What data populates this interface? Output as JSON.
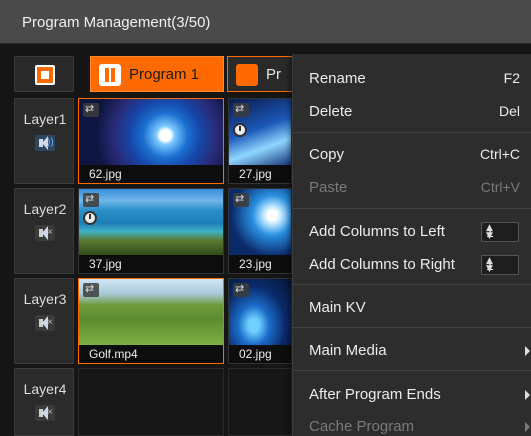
{
  "window": {
    "title": "Program Management(3/50)"
  },
  "toolbar": {
    "programs": [
      {
        "label": "Program 1",
        "state": "playing",
        "active": true
      },
      {
        "label": "Pr",
        "state": "paused",
        "active": false
      }
    ]
  },
  "layers": [
    {
      "name": "Layer1",
      "audio": "on",
      "audio_icon": "speaker-on-icon"
    },
    {
      "name": "Layer2",
      "audio": "muted",
      "audio_icon": "speaker-muted-icon"
    },
    {
      "name": "Layer3",
      "audio": "muted",
      "audio_icon": "speaker-muted-icon"
    },
    {
      "name": "Layer4",
      "audio": "muted",
      "audio_icon": "speaker-muted-icon"
    }
  ],
  "media": {
    "l1c1": {
      "file": "62.jpg"
    },
    "l1c2": {
      "file": "27.jpg"
    },
    "l2c1": {
      "file": "37.jpg"
    },
    "l2c2": {
      "file": "23.jpg"
    },
    "l3c1": {
      "file": "Golf.mp4"
    },
    "l3c2": {
      "file": "02.jpg"
    }
  },
  "context_menu": {
    "rename": {
      "label": "Rename",
      "shortcut": "F2"
    },
    "delete": {
      "label": "Delete",
      "shortcut": "Del"
    },
    "copy": {
      "label": "Copy",
      "shortcut": "Ctrl+C"
    },
    "paste": {
      "label": "Paste",
      "shortcut": "Ctrl+V",
      "disabled": true
    },
    "add_left": {
      "label": "Add Columns to Left",
      "value": "1"
    },
    "add_right": {
      "label": "Add Columns to Right",
      "value": "1"
    },
    "main_kv": {
      "label": "Main KV"
    },
    "main_media": {
      "label": "Main Media",
      "submenu": true
    },
    "after_program_ends": {
      "label": "After Program Ends",
      "submenu": true
    },
    "cache_program": {
      "label": "Cache Program",
      "submenu": true,
      "disabled": true
    }
  },
  "colors": {
    "accent": "#ff6a00",
    "title_bar": "#4a4a4a",
    "menu_bg": "#2d2d2d",
    "disabled_text": "#7a7a7a"
  }
}
